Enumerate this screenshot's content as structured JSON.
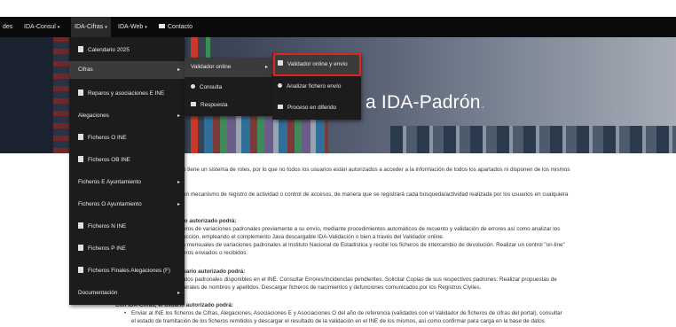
{
  "navbar": {
    "items": [
      {
        "label": "des"
      },
      {
        "label": "IDA-Consul",
        "caret": "▾"
      },
      {
        "label": "IDA-Cifras",
        "caret": "▾"
      },
      {
        "label": "IDA-Web",
        "caret": "▾"
      },
      {
        "label": "Contacto"
      }
    ]
  },
  "hero": {
    "title": "a IDA-Padrón",
    "dot": "."
  },
  "menu_cifras": {
    "items": [
      {
        "label": "Calendario 2025",
        "icon": "calendar-icon"
      },
      {
        "label": "Cifras",
        "submenu": "▸"
      },
      {
        "label": "Reparos y asociaciones E INE",
        "icon": "file-icon"
      },
      {
        "label": "Alegaciones",
        "submenu": "▸"
      },
      {
        "label": "Ficheros O INE",
        "icon": "file-icon"
      },
      {
        "label": "Ficheros OB INE",
        "icon": "file-icon"
      },
      {
        "label": "Ficheros E Ayuntamiento",
        "submenu": "▸"
      },
      {
        "label": "Ficheros O Ayuntamiento",
        "submenu": "▸"
      },
      {
        "label": "Ficheros N INE",
        "icon": "file-icon"
      },
      {
        "label": "Ficheros P INE",
        "icon": "file-icon"
      },
      {
        "label": "Ficheros Finales Alegaciones (F)",
        "icon": "file-icon"
      },
      {
        "label": "Documentación",
        "submenu": "▸"
      }
    ]
  },
  "menu_validador": {
    "items": [
      {
        "label": "Validador online",
        "submenu": "▸"
      },
      {
        "label": "Consulta",
        "icon": "search-icon"
      },
      {
        "label": "Respuesta",
        "icon": "download-icon"
      }
    ]
  },
  "menu_online": {
    "items": [
      {
        "label": "Validador online y envío",
        "icon": "checkbox-icon"
      },
      {
        "label": "Analizar fichero envío",
        "icon": "search-icon"
      },
      {
        "label": "Proceso en diferido",
        "icon": "download-icon"
      }
    ]
  },
  "content": {
    "lines": [
      "o tiene un sistema de roles, por lo que no todos los usuarios están autorizados a acceder a la información de todos los apartados ni disponen de los mismos",
      "un mecanismo de registro de actividad o control de accesos, de manera que se registrará cada búsqueda/actividad realizada por los usuarios en cualquiera",
      "io autorizado podrá:",
      "eros de variaciones padronales previamente a su envío, mediante procedimientos automáticos de recuento y validación de errores así como analizar los",
      "ucción, empleando el complemento Java descargable IDA-Validación o bien a través del Validador online.",
      "s mensuales de variaciones padronales al Instituto Nacional de Estadística y recibir los ficheros de intercambio de devolución. Realizar un control \"on-line\"",
      "eros enviados o recibidos.",
      "uario autorizado podrá:",
      "atos padronales disponibles en el INE. Consultar Errores/Incidencias pendientes. Solicitar Copias de sus respectivos padrones. Realizar propuestas de",
      "terales de nombres y apellidos. Descargar ficheros de nacimientos y defunciones comunicados por los Registros Civiles.",
      "Con IDA-Cifras, el usuario autorizado podrá:",
      "Enviar al INE los ficheros de Cifras, Alegaciones, Asociaciones E y Asociaciones O del año de referencia (validados con el Validador de ficheros de cifras del portal), consultar",
      "el estado de tramitación de los ficheros remitidos y descargar el resultado de la validación en el INE de los mismos, así como confirmar para carga en la base de datos"
    ]
  }
}
